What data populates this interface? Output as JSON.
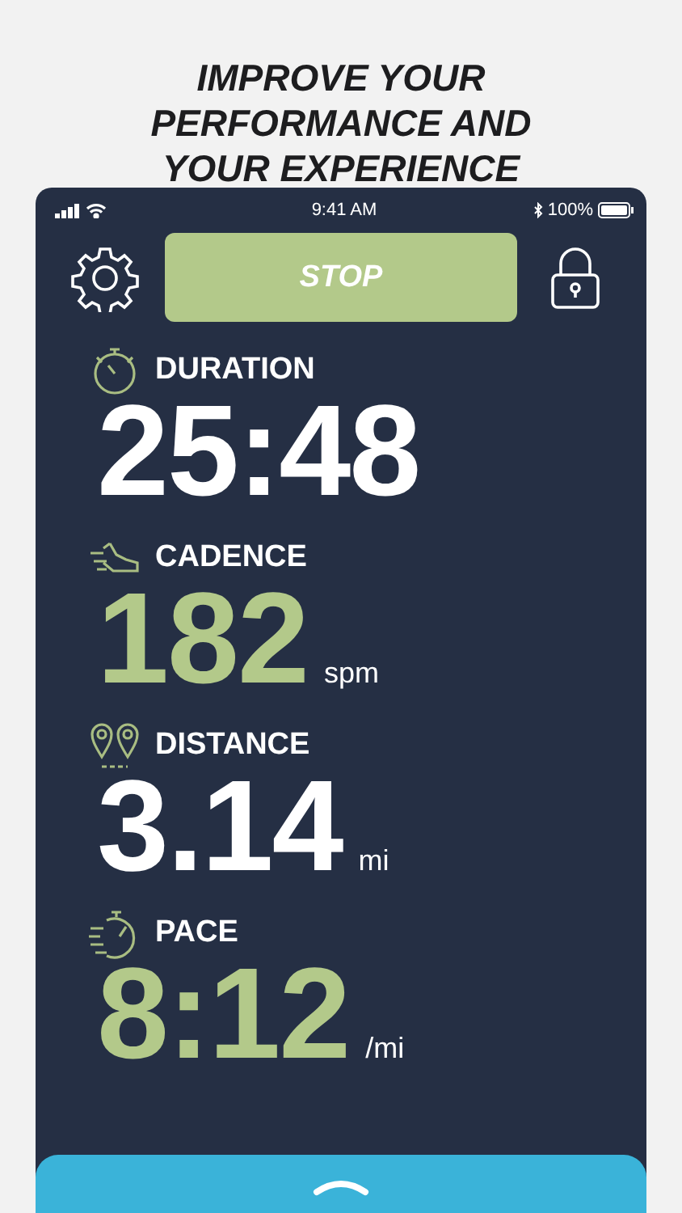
{
  "headline": "IMPROVE YOUR PERFORMANCE AND YOUR EXPERIENCE",
  "status_bar": {
    "time": "9:41 AM",
    "battery": "100%"
  },
  "stop_button": {
    "label": "STOP"
  },
  "metrics": [
    {
      "kind": "duration",
      "label": "DURATION",
      "value": "25:48",
      "color": "#ffffff"
    },
    {
      "kind": "cadence",
      "label": "CADENCE",
      "value": "182",
      "unit": "spm",
      "color": "#b3c98a"
    },
    {
      "kind": "distance",
      "label": "DISTANCE",
      "value": "3.14",
      "unit": "mi",
      "color": "#ffffff"
    },
    {
      "kind": "pace",
      "label": "PACE",
      "value": "8:12",
      "unit": "/mi",
      "color": "#b3c98a"
    }
  ]
}
